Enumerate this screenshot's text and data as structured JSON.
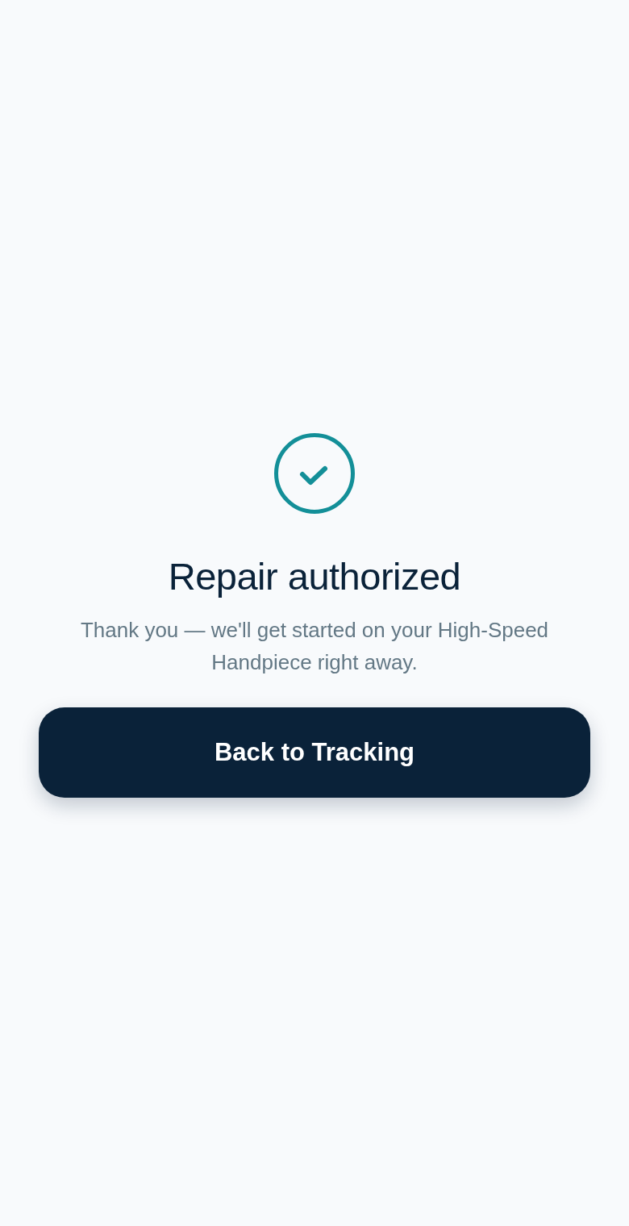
{
  "confirmation": {
    "title": "Repair authorized",
    "message": "Thank you — we'll get started on your High-Speed Handpiece right away."
  },
  "primary_button": {
    "label": "Back to Tracking"
  }
}
